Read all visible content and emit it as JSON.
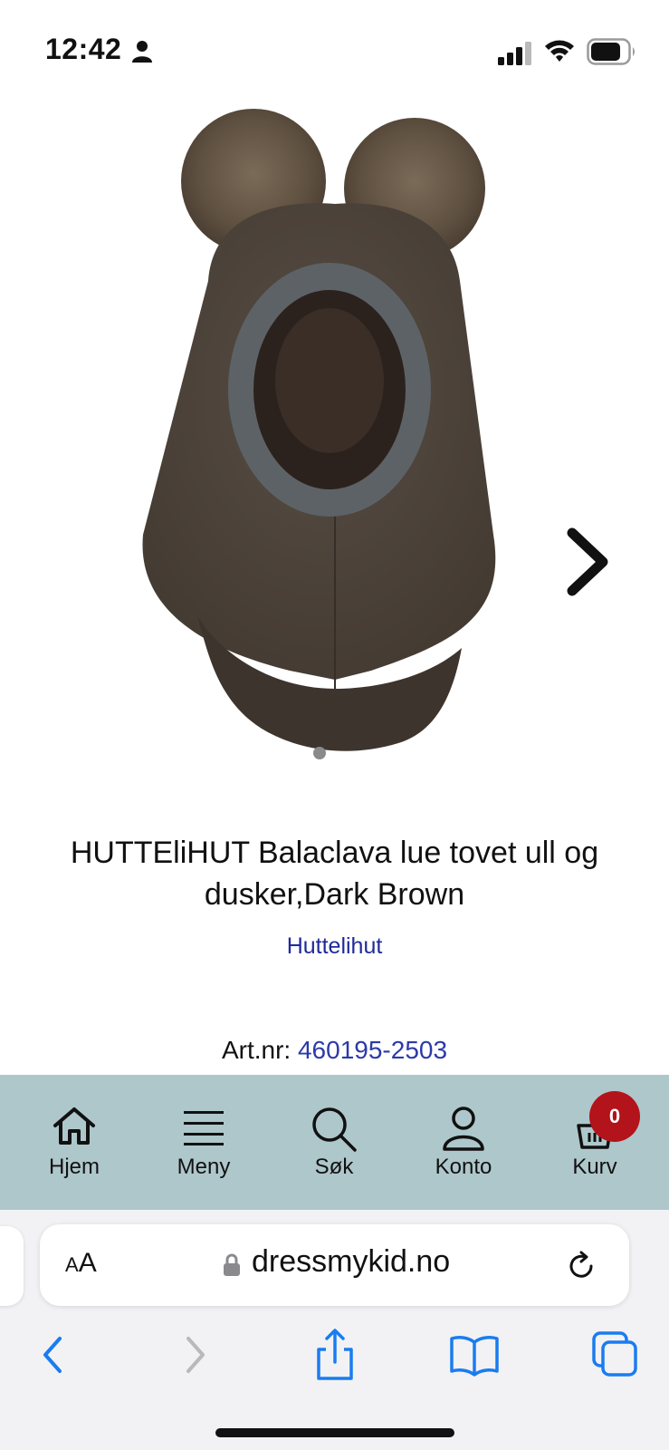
{
  "status_bar": {
    "time": "12:42",
    "icons": [
      "person-icon",
      "signal-icon",
      "wifi-icon",
      "battery-icon"
    ]
  },
  "gallery": {
    "image_description_icon": "balaclava-product-image",
    "next_icon": "chevron-right-icon"
  },
  "product": {
    "title": "HUTTEliHUT Balaclava lue tovet ull og dusker,Dark Brown",
    "brand": "Huttelihut",
    "artnr_label": "Art.nr:",
    "artnr_value": "460195-2503"
  },
  "bottom_nav": {
    "items": [
      {
        "label": "Hjem",
        "icon": "home-icon"
      },
      {
        "label": "Meny",
        "icon": "menu-icon"
      },
      {
        "label": "Søk",
        "icon": "search-icon"
      },
      {
        "label": "Konto",
        "icon": "user-icon"
      },
      {
        "label": "Kurv",
        "icon": "basket-icon"
      }
    ],
    "cart_count": "0"
  },
  "safari": {
    "aa_small": "A",
    "aa_large": "A",
    "url": "dressmykid.no",
    "toolbar": [
      "back-icon",
      "forward-icon",
      "share-icon",
      "bookmarks-icon",
      "tabs-icon"
    ]
  },
  "colors": {
    "nav_background": "#aec7cb",
    "link": "#1f2a9a",
    "badge": "#b3131a",
    "ios_blue": "#1a7cf0"
  }
}
